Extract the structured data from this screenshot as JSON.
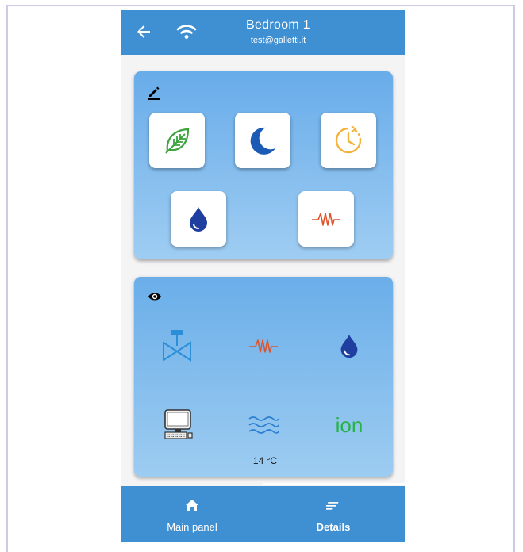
{
  "header": {
    "title": "Bedroom 1",
    "subtitle": "test@galletti.it",
    "back_icon": "arrow-left-icon",
    "status_icon": "wifi-icon"
  },
  "settings_card": {
    "edit_icon": "edit-icon",
    "buttons": [
      {
        "icon": "leaf-icon",
        "color": "#3aa33a"
      },
      {
        "icon": "moon-icon",
        "color": "#1c5bb5"
      },
      {
        "icon": "timer-icon",
        "color": "#f3b33d"
      },
      {
        "icon": "drop-icon",
        "color": "#1e3ea0"
      },
      {
        "icon": "heater-icon",
        "color": "#e0532a"
      }
    ]
  },
  "status_card": {
    "view_icon": "eye-icon",
    "items": [
      {
        "icon": "valve-icon",
        "color": "#2a8fd6"
      },
      {
        "icon": "heater-icon",
        "color": "#e0532a"
      },
      {
        "icon": "drop-icon",
        "color": "#1e3ea0"
      },
      {
        "icon": "computer-icon",
        "color": "#333333"
      },
      {
        "icon": "waves-icon",
        "color": "#2a7fd0"
      },
      {
        "icon": "ion-icon",
        "label": "ion",
        "color": "#28b34a"
      }
    ],
    "temperature": "14 °C"
  },
  "tabs": [
    {
      "label": "Main panel",
      "icon": "home-icon",
      "active": false
    },
    {
      "label": "Details",
      "icon": "details-icon",
      "active": true
    }
  ]
}
